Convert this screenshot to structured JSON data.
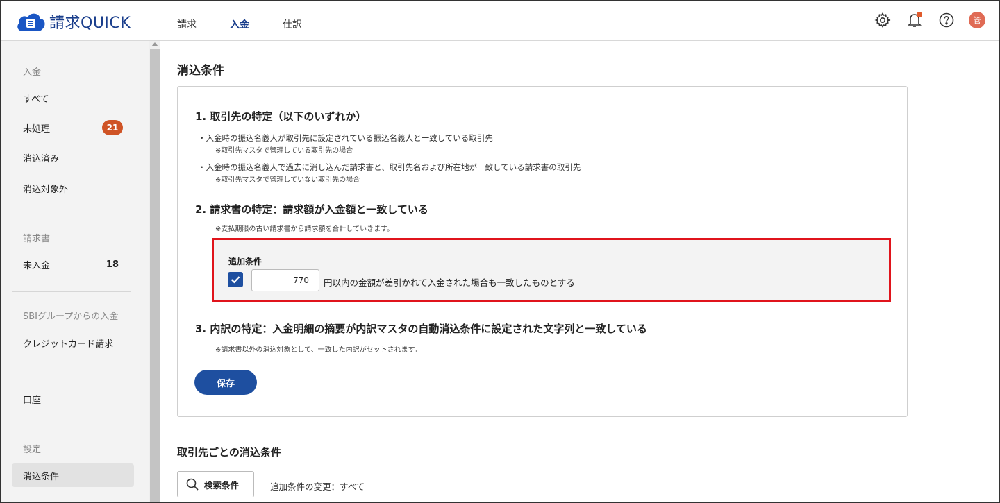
{
  "app": {
    "logo_text": "請求QUICK",
    "brand_color": "#1a3e8c",
    "accent_color": "#1e4fa0"
  },
  "nav": {
    "items": [
      {
        "label": "請求",
        "active": false
      },
      {
        "label": "入金",
        "active": true
      },
      {
        "label": "仕訳",
        "active": false
      }
    ]
  },
  "header": {
    "icons": [
      "gear-icon",
      "bell-icon",
      "help-icon"
    ],
    "avatar_text": "管"
  },
  "sidebar": {
    "section_payment": "入金",
    "item_all": "すべて",
    "item_unprocessed": "未処理",
    "unprocessed_count": "21",
    "item_reconciled": "消込済み",
    "item_excluded": "消込対象外",
    "section_invoice": "請求書",
    "item_unpaid": "未入金",
    "unpaid_count": "18",
    "section_sbi": "SBIグループからの入金",
    "item_credit": "クレジットカード請求",
    "item_account": "口座",
    "section_settings": "設定",
    "item_conditions": "消込条件"
  },
  "main": {
    "title": "消込条件",
    "cond1": {
      "heading": "1.  取引先の特定（以下のいずれか）",
      "desc1": "・入金時の振込名義人が取引先に設定されている振込名義人と一致している取引先",
      "note1": "※取引先マスタで管理している取引先の場合",
      "desc2": "・入金時の振込名義人で過去に消し込んだ請求書と、取引先名および所在地が一致している請求書の取引先",
      "note2": "※取引先マスタで管理していない取引先の場合"
    },
    "cond2": {
      "heading": "2.  請求書の特定：請求額が入金額と一致している",
      "note": "※支払期限の古い請求書から請求額を合計していきます。"
    },
    "extra": {
      "label": "追加条件",
      "checked": true,
      "amount": "770",
      "text": "円以内の金額が差引かれて入金された場合も一致したものとする"
    },
    "cond3": {
      "heading": "3.  内訳の特定：入金明細の摘要が内訳マスタの自動消込条件に設定された文字列と一致している",
      "note": "※請求書以外の消込対象として、一致した内訳がセットされます。"
    },
    "save_label": "保存",
    "per_client_title": "取引先ごとの消込条件",
    "search_label": "検索条件",
    "filter_text": "追加条件の変更：すべて"
  }
}
